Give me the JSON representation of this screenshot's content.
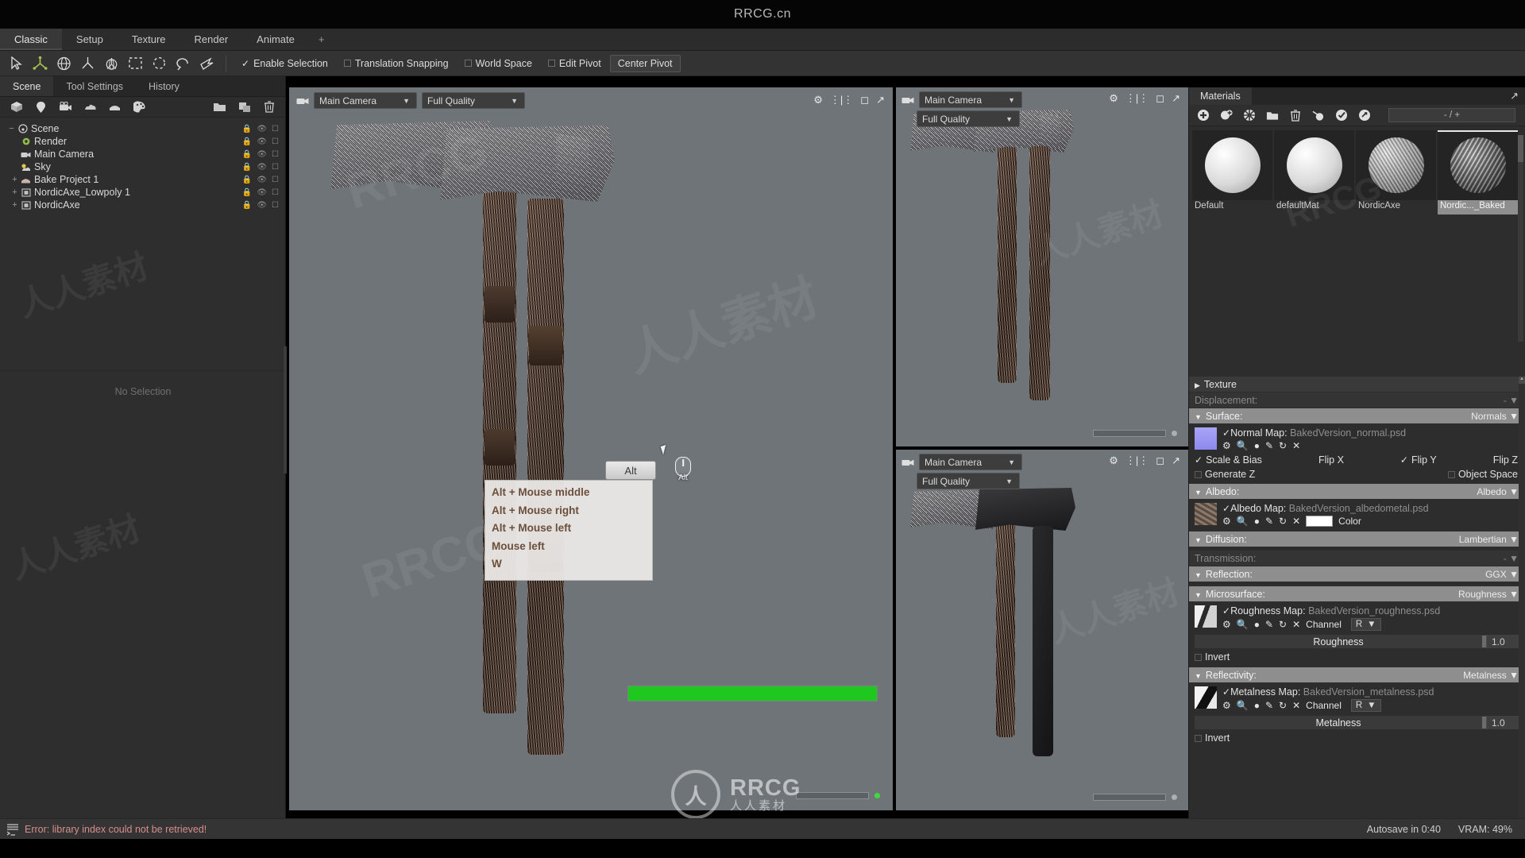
{
  "titlebar": {
    "title": "RRCG.cn"
  },
  "menu": {
    "tabs": [
      {
        "label": "Classic",
        "active": true
      },
      {
        "label": "Setup",
        "active": false
      },
      {
        "label": "Texture",
        "active": false
      },
      {
        "label": "Render",
        "active": false
      },
      {
        "label": "Animate",
        "active": false
      },
      {
        "label": "+",
        "active": false
      }
    ]
  },
  "toolbar": {
    "icons": [
      {
        "name": "select-arrow-icon",
        "active": false
      },
      {
        "name": "move-gizmo-icon",
        "active": true
      },
      {
        "name": "rotate-gizmo-icon",
        "active": false
      },
      {
        "name": "scale-gizmo-icon",
        "active": false
      },
      {
        "name": "transform-gizmo-icon",
        "active": false
      },
      {
        "name": "rect-marquee-icon",
        "active": false
      },
      {
        "name": "circle-marquee-icon",
        "active": false
      },
      {
        "name": "lasso-marquee-icon",
        "active": false
      },
      {
        "name": "polygon-lasso-icon",
        "active": false
      }
    ],
    "options": [
      {
        "label": "Enable Selection",
        "type": "check",
        "checked": true
      },
      {
        "label": "Translation Snapping",
        "type": "check",
        "checked": false
      },
      {
        "label": "World Space",
        "type": "check",
        "checked": false
      },
      {
        "label": "Edit Pivot",
        "type": "check",
        "checked": false
      },
      {
        "label": "Center Pivot",
        "type": "button",
        "checked": false
      }
    ]
  },
  "left_panel": {
    "tabs": [
      {
        "label": "Scene",
        "active": true
      },
      {
        "label": "Tool Settings",
        "active": false
      },
      {
        "label": "History",
        "active": false
      }
    ],
    "toolbar_icons": [
      "add-mesh-icon",
      "add-light-icon",
      "add-camera-icon",
      "add-sky-icon",
      "add-bake-icon",
      "add-material-icon",
      "folder-icon",
      "duplicate-icon",
      "trash-icon"
    ],
    "tree": [
      {
        "label": "Scene",
        "indent": 0,
        "expander": "−",
        "icon": "scene-icon"
      },
      {
        "label": "Render",
        "indent": 1,
        "expander": "",
        "icon": "render-gear-icon"
      },
      {
        "label": "Main Camera",
        "indent": 1,
        "expander": "",
        "icon": "camera-icon"
      },
      {
        "label": "Sky",
        "indent": 1,
        "expander": "",
        "icon": "sky-icon"
      },
      {
        "label": "Bake Project 1",
        "indent": 1,
        "expander": "+",
        "icon": "bake-icon"
      },
      {
        "label": "NordicAxe_Lowpoly 1",
        "indent": 1,
        "expander": "+",
        "icon": "mesh-icon"
      },
      {
        "label": "NordicAxe",
        "indent": 1,
        "expander": "+",
        "icon": "mesh-icon"
      }
    ],
    "no_selection": "No Selection"
  },
  "viewports": [
    {
      "id": "main",
      "camera": "Main Camera",
      "quality": "Full Quality",
      "layout": "row"
    },
    {
      "id": "right-top",
      "camera": "Main Camera",
      "quality": "Full Quality",
      "layout": "stack"
    },
    {
      "id": "right-bottom",
      "camera": "Main Camera",
      "quality": "Full Quality",
      "layout": "stack"
    }
  ],
  "viewport_tools": [
    "settings-gear-icon",
    "split-view-icon",
    "maximize-icon",
    "popout-icon"
  ],
  "hotkey_overlay": {
    "key_badge": "Alt",
    "mouse_label": "Alt",
    "items": [
      "Alt + Mouse middle",
      "Alt + Mouse right",
      "Alt + Mouse left",
      "Mouse left",
      "W"
    ]
  },
  "progress": {
    "percent": 100
  },
  "materials": {
    "tab_label": "Materials",
    "toolbar_icons": [
      "add-material-icon",
      "duplicate-material-icon",
      "clear-material-icon",
      "folder-icon",
      "trash-icon",
      "assign-icon",
      "check-circle-icon",
      "link-icon"
    ],
    "count_label": "- / +",
    "items": [
      {
        "name": "Default",
        "thumb": "white",
        "selected": false
      },
      {
        "name": "defaultMat",
        "thumb": "white",
        "selected": false
      },
      {
        "name": "NordicAxe",
        "thumb": "axe1",
        "selected": false
      },
      {
        "name": "Nordic..._Baked",
        "thumb": "axe2",
        "selected": true
      }
    ]
  },
  "properties": {
    "texture": {
      "label": "Texture",
      "collapsed": true
    },
    "displacement": {
      "label": "Displacement:",
      "value": "-",
      "disabled": true
    },
    "surface": {
      "label": "Surface:",
      "value": "Normals",
      "map_label": "Normal Map:",
      "map_file": "BakedVersion_normal.psd",
      "map_checked": true,
      "icons": [
        "gear-icon",
        "search-icon",
        "eyedropper-icon",
        "pencil-icon",
        "reload-icon",
        "close-icon"
      ],
      "toggles": [
        {
          "label": "Scale & Bias",
          "checked": true
        },
        {
          "label": "Flip X",
          "checked": false
        },
        {
          "label": "Flip Y",
          "checked": true
        },
        {
          "label": "Flip Z",
          "checked": false
        },
        {
          "label": "Generate Z",
          "checked": false
        },
        {
          "label": "Object Space",
          "checked": false
        }
      ]
    },
    "albedo": {
      "label": "Albedo:",
      "value": "Albedo",
      "map_label": "Albedo Map:",
      "map_file": "BakedVersion_albedometal.psd",
      "map_checked": true,
      "icons": [
        "gear-icon",
        "search-icon",
        "eyedropper-icon",
        "pencil-icon",
        "reload-icon",
        "close-icon"
      ],
      "color_label": "Color",
      "color_hex": "#ffffff"
    },
    "diffusion": {
      "label": "Diffusion:",
      "value": "Lambertian"
    },
    "transmission": {
      "label": "Transmission:",
      "value": "-",
      "disabled": true
    },
    "reflection": {
      "label": "Reflection:",
      "value": "GGX"
    },
    "microsurface": {
      "label": "Microsurface:",
      "value": "Roughness",
      "map_label": "Roughness Map:",
      "map_file": "BakedVersion_roughness.psd",
      "map_checked": true,
      "icons": [
        "gear-icon",
        "search-icon",
        "eyedropper-icon",
        "pencil-icon",
        "reload-icon",
        "close-icon"
      ],
      "channel_label": "Channel",
      "channel_value": "R",
      "slider_label": "Roughness",
      "slider_value": "1.0",
      "invert_label": "Invert",
      "invert_checked": false
    },
    "reflectivity": {
      "label": "Reflectivity:",
      "value": "Metalness",
      "map_label": "Metalness Map:",
      "map_file": "BakedVersion_metalness.psd",
      "map_checked": true,
      "icons": [
        "gear-icon",
        "search-icon",
        "eyedropper-icon",
        "pencil-icon",
        "reload-icon",
        "close-icon"
      ],
      "channel_label": "Channel",
      "channel_value": "R",
      "slider_label": "Metalness",
      "slider_value": "1.0",
      "invert_label": "Invert",
      "invert_checked": false
    }
  },
  "statusbar": {
    "error": "Error: library index could not be retrieved!",
    "autosave": "Autosave in 0:40",
    "vram": "VRAM: 49%"
  },
  "watermarks": {
    "logo_mark": "人",
    "logo_line1": "RRCG",
    "logo_line2": "人人素材",
    "texts": [
      "RRCG",
      "人人素材",
      "RRCG",
      "人人素材",
      "RRCG"
    ]
  },
  "colors": {
    "accent_green": "#1ec81e",
    "gizmo_green": "#a8c24a",
    "error_red": "#d98c8c",
    "viewport_bg": "#6e7478"
  }
}
